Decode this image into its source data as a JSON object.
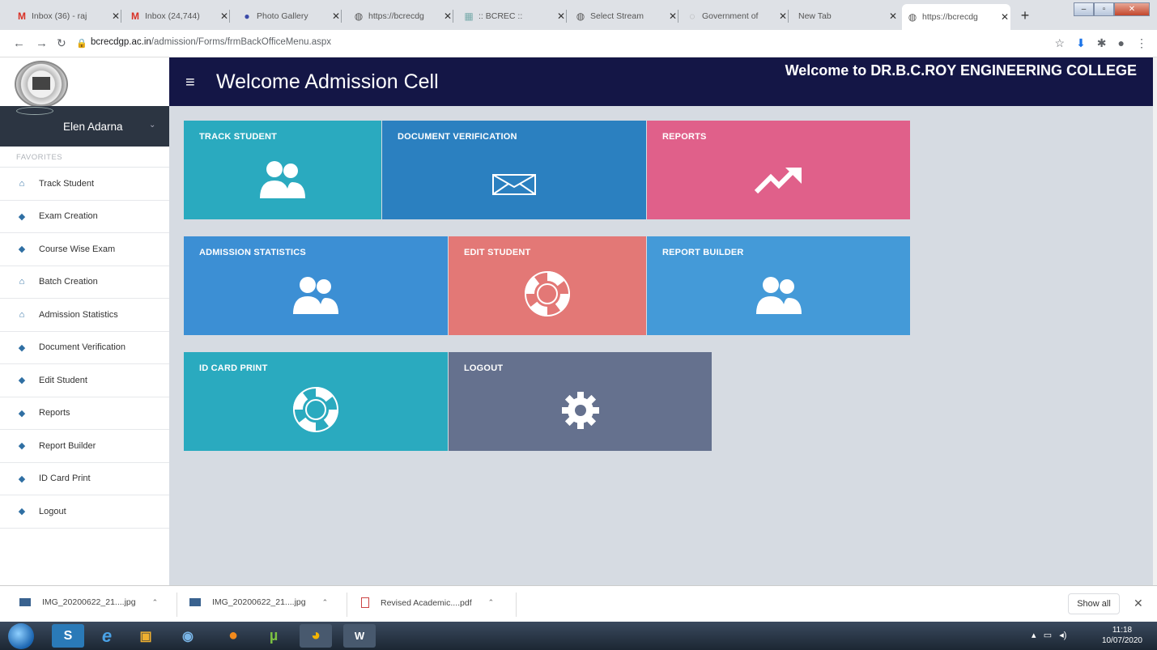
{
  "browser": {
    "tabs": [
      {
        "title": "Inbox (36) - raj",
        "icon": "gmail-icon"
      },
      {
        "title": "Inbox (24,744)",
        "icon": "gmail-icon"
      },
      {
        "title": "Photo Gallery",
        "icon": "site-icon"
      },
      {
        "title": "https://bcrecdg",
        "icon": "globe-icon"
      },
      {
        "title": ":: BCREC ::",
        "icon": "site-icon"
      },
      {
        "title": "Select Stream",
        "icon": "globe-icon"
      },
      {
        "title": "Government of",
        "icon": "site-icon"
      },
      {
        "title": "New Tab",
        "icon": ""
      },
      {
        "title": "https://bcrecdg",
        "icon": "globe-icon"
      }
    ],
    "url_host": "bcrecdgp.ac.in",
    "url_path": "/admission/Forms/frmBackOfficeMenu.aspx"
  },
  "sidebar": {
    "user_name": "Elen Adarna",
    "favorites_label": "FAVORITES",
    "items": [
      {
        "label": "Track Student",
        "icon": "home-icon"
      },
      {
        "label": "Exam Creation",
        "icon": "cube-icon"
      },
      {
        "label": "Course Wise Exam",
        "icon": "cube-icon"
      },
      {
        "label": "Batch Creation",
        "icon": "home-icon"
      },
      {
        "label": "Admission Statistics",
        "icon": "home-icon"
      },
      {
        "label": "Document Verification",
        "icon": "cube-icon"
      },
      {
        "label": "Edit Student",
        "icon": "cube-icon"
      },
      {
        "label": "Reports",
        "icon": "cube-icon"
      },
      {
        "label": "Report Builder",
        "icon": "cube-icon"
      },
      {
        "label": "ID Card Print",
        "icon": "cube-icon"
      },
      {
        "label": "Logout",
        "icon": "cube-icon"
      }
    ]
  },
  "header": {
    "title": "Welcome Admission Cell",
    "welcome": "Welcome to DR.B.C.ROY ENGINEERING COLLEGE"
  },
  "tiles": [
    {
      "label": "TRACK STUDENT",
      "icon": "users-icon",
      "color": "#2aaabf"
    },
    {
      "label": "DOCUMENT VERIFICATION",
      "icon": "envelope-icon",
      "color": "#2b80c0"
    },
    {
      "label": "REPORTS",
      "icon": "trend-up-icon",
      "color": "#e0608a"
    },
    {
      "label": "ADMISSION STATISTICS",
      "icon": "users-icon",
      "color": "#3c8fd4"
    },
    {
      "label": "EDIT STUDENT",
      "icon": "lifebuoy-icon",
      "color": "#e37876"
    },
    {
      "label": "REPORT BUILDER",
      "icon": "users-icon",
      "color": "#449ad8"
    },
    {
      "label": "ID CARD PRINT",
      "icon": "lifebuoy-icon",
      "color": "#2aaabf"
    },
    {
      "label": "LOGOUT",
      "icon": "gear-icon",
      "color": "#65718e"
    }
  ],
  "downloads": [
    {
      "name": "IMG_20200622_21....jpg"
    },
    {
      "name": "IMG_20200622_21....jpg"
    },
    {
      "name": "Revised Academic....pdf"
    }
  ],
  "downloads_show_all": "Show all",
  "taskbar": {
    "time": "11:18",
    "date": "10/07/2020"
  }
}
